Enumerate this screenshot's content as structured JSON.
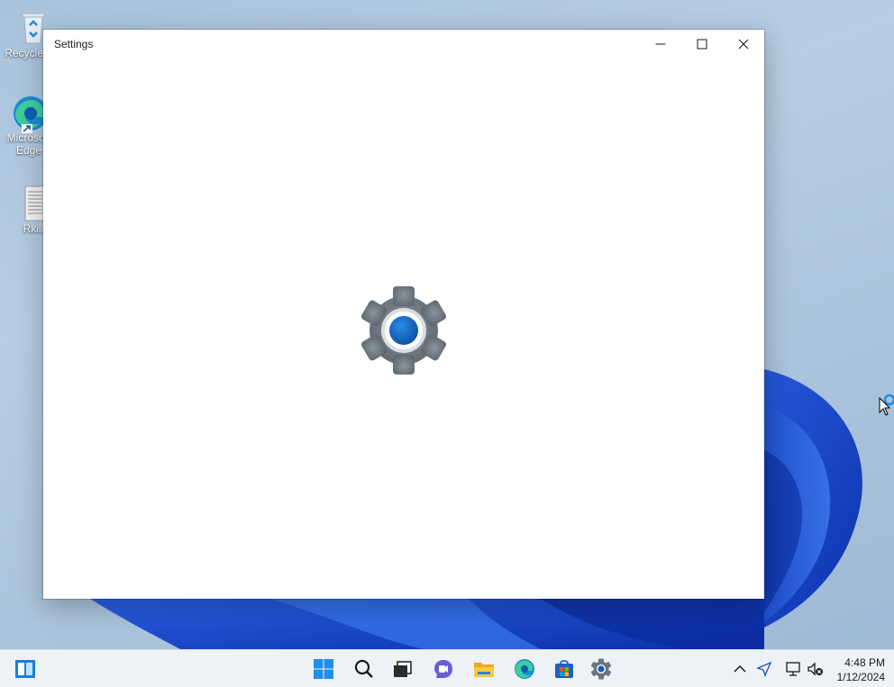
{
  "window": {
    "title": "Settings"
  },
  "desktop": {
    "icons": [
      {
        "label": "Recycle Bin",
        "icon": "recycle-bin-icon"
      },
      {
        "label": "Microsoft Edge",
        "icon": "edge-icon"
      },
      {
        "label": "Rkill",
        "icon": "text-file-icon"
      }
    ]
  },
  "taskbar": {
    "items": [
      {
        "icon": "widgets-icon"
      },
      {
        "icon": "start-icon"
      },
      {
        "icon": "search-icon"
      },
      {
        "icon": "task-view-icon"
      },
      {
        "icon": "chat-icon"
      },
      {
        "icon": "file-explorer-icon"
      },
      {
        "icon": "edge-icon"
      },
      {
        "icon": "store-icon"
      },
      {
        "icon": "settings-icon"
      }
    ],
    "tray": [
      {
        "icon": "chevron-up-icon"
      },
      {
        "icon": "location-icon"
      },
      {
        "icon": "network-icon"
      },
      {
        "icon": "volume-muted-icon"
      }
    ],
    "clock": {
      "time": "4:48 PM",
      "date": "1/12/2024"
    }
  },
  "colors": {
    "accent": "#0067c0",
    "taskbar_bg": "#eef1f6",
    "desktop_bg": "#aec6dd",
    "bloom_blue": "#1a4fd0"
  }
}
